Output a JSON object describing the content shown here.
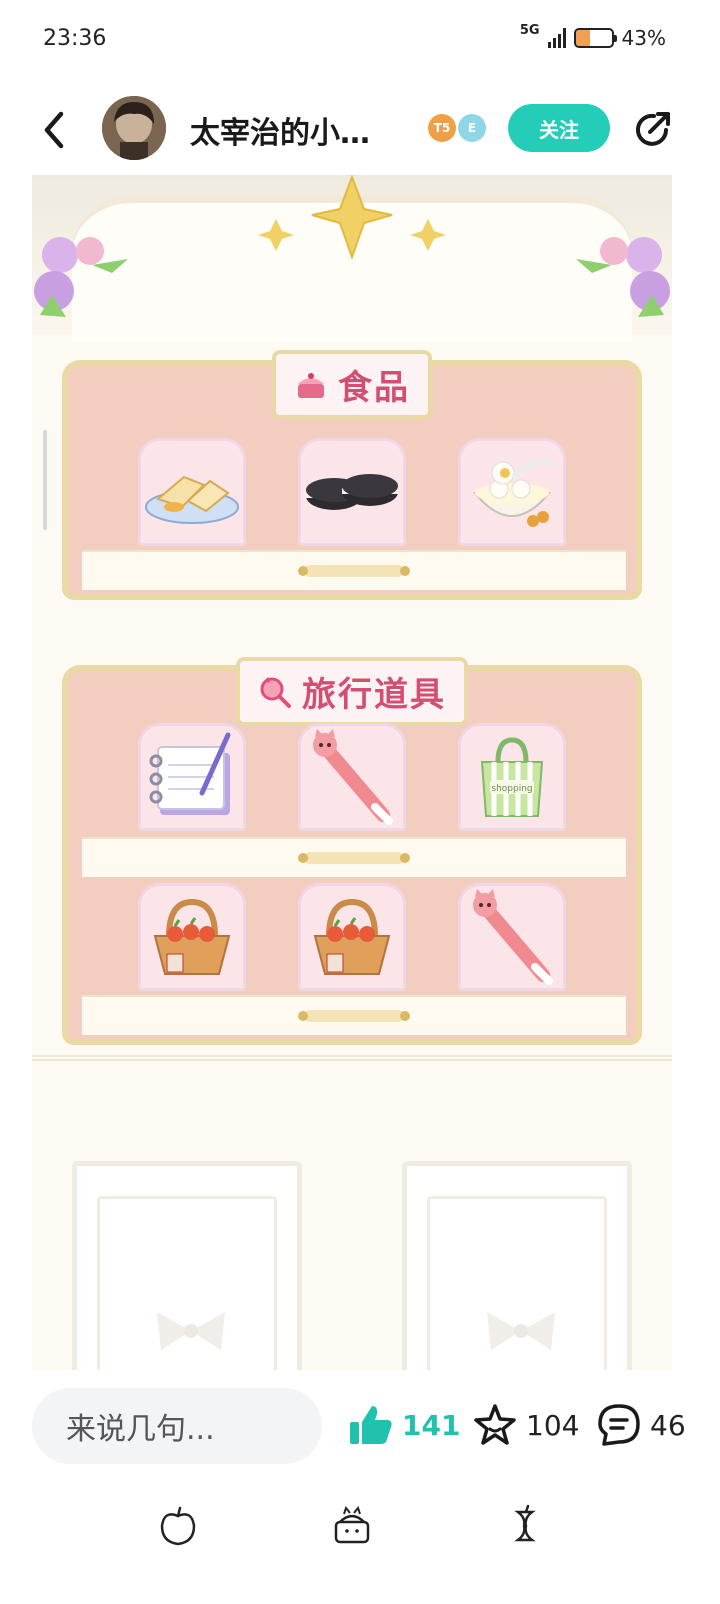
{
  "status_bar": {
    "time": "23:36",
    "network": "5G",
    "battery": "43%",
    "battery_level": 0.43
  },
  "header": {
    "profile_name": "太宰治的小…",
    "follow_label": "关注",
    "badges": [
      {
        "text": "T5",
        "color": "#f0a044"
      },
      {
        "text": "E",
        "color": "#8fd6e6"
      }
    ],
    "icons": {
      "back": "chevron-left-icon",
      "share": "share-icon"
    }
  },
  "content": {
    "shelves": [
      {
        "title": "食品",
        "icon": "cake-icon",
        "rows": [
          [
            "toast-sandwich",
            "sandwich-cookies",
            "rice-ball-soup"
          ]
        ]
      },
      {
        "title": "旅行道具",
        "icon": "magnifier-icon",
        "rows": [
          [
            "notebook-pen",
            "cat-pen",
            "shopping-bag"
          ],
          [
            "snack-basket",
            "snack-basket",
            "cat-pen"
          ]
        ]
      }
    ],
    "shopping_bag_print": "shopping"
  },
  "actions": {
    "comment_placeholder": "来说几句...",
    "likes": "141",
    "favorites": "104",
    "comments": "46",
    "accent_color": "#20c1ad"
  },
  "bottom_nav": {
    "items": [
      "apple-icon",
      "cake-cat-icon",
      "apple-core-icon"
    ]
  }
}
